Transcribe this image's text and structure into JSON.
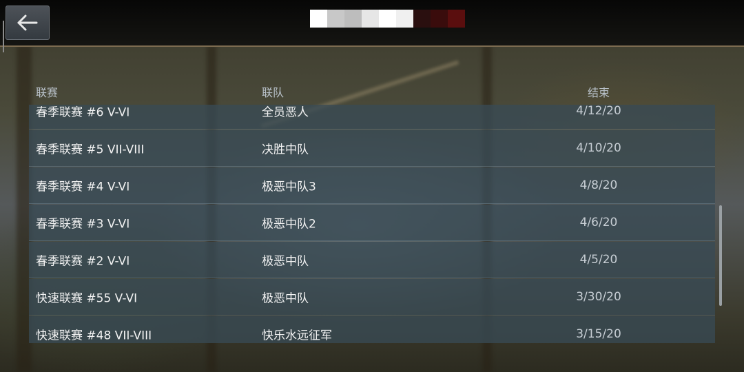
{
  "columns": {
    "league": "联赛",
    "team": "联队",
    "end": "结束"
  },
  "rows": [
    {
      "league": "春季联赛 #6 V-VI",
      "team": "全员恶人",
      "end": "4/12/20"
    },
    {
      "league": "春季联赛 #5 VII-VIII",
      "team": "决胜中队",
      "end": "4/10/20"
    },
    {
      "league": "春季联赛 #4 V-VI",
      "team": "极恶中队3",
      "end": "4/8/20"
    },
    {
      "league": "春季联赛 #3 V-VI",
      "team": "极恶中队2",
      "end": "4/6/20"
    },
    {
      "league": "春季联赛 #2 V-VI",
      "team": "极恶中队",
      "end": "4/5/20"
    },
    {
      "league": "快速联赛 #55 V-VI",
      "team": "极恶中队",
      "end": "3/30/20"
    },
    {
      "league": "快速联赛 #48 VII-VIII",
      "team": "快乐水远征军",
      "end": "3/15/20"
    }
  ],
  "icons": {
    "back": "back-arrow-icon"
  },
  "colors": {
    "row_bg": "#384a54",
    "header_text": "#b9c2ca",
    "accent_line": "#7c6b50",
    "title_pixels": [
      "#ffffff",
      "#c8c8c8",
      "#bdbdbd",
      "#e6e6e6",
      "#ffffff",
      "#f0f0f0",
      "#2a0f0f",
      "#3a0c0c",
      "#5a0e0e"
    ]
  }
}
